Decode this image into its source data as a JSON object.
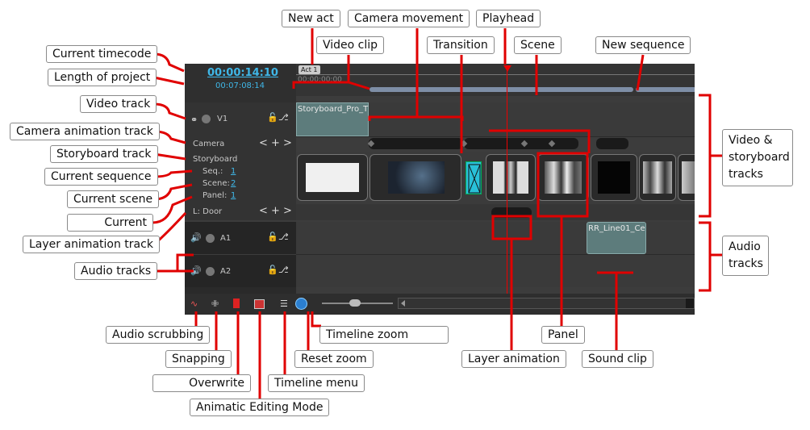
{
  "callouts": {
    "new_act": "New act",
    "camera_movement": "Camera movement",
    "playhead": "Playhead",
    "video_clip": "Video clip",
    "transition": "Transition",
    "scene": "Scene",
    "new_sequence": "New sequence",
    "current_timecode": "Current timecode",
    "length_of_project": "Length of project",
    "video_track": "Video track",
    "camera_animation_track": "Camera animation track",
    "storyboard_track": "Storyboard track",
    "current_sequence": "Current sequence",
    "current_scene": "Current scene",
    "current": "Current",
    "layer_animation_track": "Layer animation track",
    "audio_tracks": "Audio tracks",
    "video_storyboard_tracks": "Video & storyboard tracks",
    "audio_tracks_right": "Audio tracks",
    "audio_scrubbing": "Audio scrubbing",
    "snapping": "Snapping",
    "overwrite": "Overwrite",
    "animatic_editing_mode": "Animatic Editing Mode",
    "timeline_menu": "Timeline menu",
    "timeline_zoom": "Timeline zoom",
    "reset_zoom": "Reset zoom",
    "layer_animation": "Layer animation",
    "panel": "Panel",
    "sound_clip": "Sound clip"
  },
  "timeline": {
    "current_timecode": "00:00:14:10",
    "project_length": "00:07:08:14",
    "ruler_time": "00:00:00:00",
    "act_label": "Act 1",
    "video_track": {
      "name": "V1",
      "clip_name": "Storyboard_Pro_T"
    },
    "camera_track": {
      "name": "Camera",
      "controls": "< + >"
    },
    "storyboard": {
      "title": "Storyboard",
      "seq_label": "Seq.:",
      "seq_value": "1",
      "scene_label": "Scene:",
      "scene_value": "2",
      "panel_label": "Panel:",
      "panel_value": "1"
    },
    "layer_track": {
      "name": "L: Door",
      "controls": "< + >"
    },
    "audio_tracks": [
      {
        "name": "A1",
        "clip_name": "RR_Line01_Ce"
      },
      {
        "name": "A2"
      }
    ]
  },
  "icons": {
    "audio_scrubbing": "audio-scrub-icon",
    "snapping": "snapping-icon",
    "overwrite": "overwrite-icon",
    "animatic_mode": "animatic-mode-icon",
    "timeline_menu": "timeline-menu-icon",
    "reset_zoom": "reset-zoom-icon"
  },
  "colors": {
    "accent_red": "#e00000",
    "link_blue": "#3fb7e8",
    "panel_bg": "#3c3c3c",
    "clip_teal": "#5d7c7c"
  }
}
